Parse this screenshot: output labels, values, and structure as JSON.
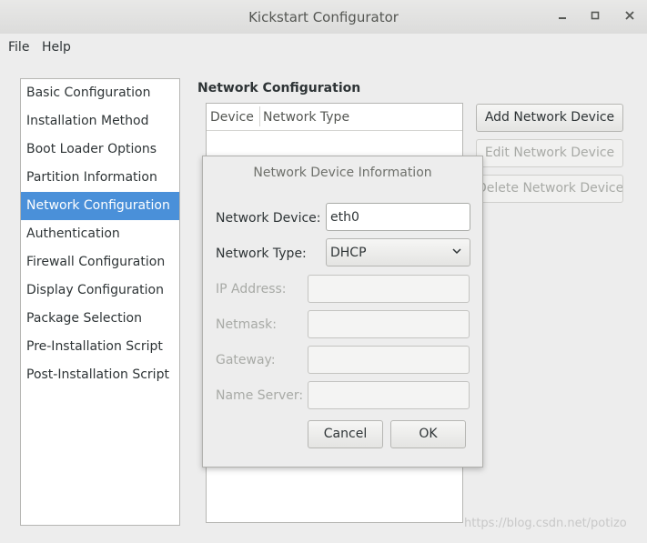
{
  "window": {
    "title": "Kickstart Configurator"
  },
  "menu": {
    "file": "File",
    "help": "Help"
  },
  "sidebar": {
    "items": [
      {
        "label": "Basic Configuration"
      },
      {
        "label": "Installation Method"
      },
      {
        "label": "Boot Loader Options"
      },
      {
        "label": "Partition Information"
      },
      {
        "label": "Network Configuration",
        "selected": true
      },
      {
        "label": "Authentication"
      },
      {
        "label": "Firewall Configuration"
      },
      {
        "label": "Display Configuration"
      },
      {
        "label": "Package Selection"
      },
      {
        "label": "Pre-Installation Script"
      },
      {
        "label": "Post-Installation Script"
      }
    ]
  },
  "main": {
    "title": "Network Configuration",
    "table": {
      "columns": [
        "Device",
        "Network Type"
      ]
    },
    "buttons": {
      "add": "Add Network Device",
      "edit": "Edit Network Device",
      "delete": "Delete Network Device"
    }
  },
  "dialog": {
    "title": "Network Device Information",
    "network_device_label": "Network Device:",
    "network_device_value": "eth0",
    "network_type_label": "Network Type:",
    "network_type_value": "DHCP",
    "ip_label": "IP Address:",
    "netmask_label": "Netmask:",
    "gateway_label": "Gateway:",
    "nameserver_label": "Name Server:",
    "cancel": "Cancel",
    "ok": "OK"
  },
  "watermark": "https://blog.csdn.net/potizo",
  "colors": {
    "selection": "#4a90d9",
    "background": "#ededed"
  }
}
